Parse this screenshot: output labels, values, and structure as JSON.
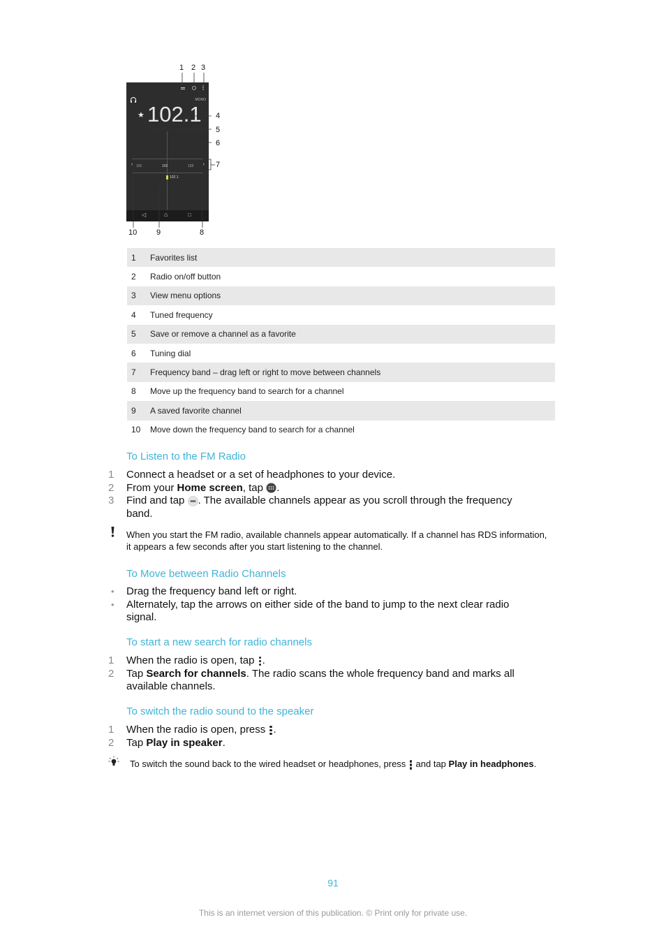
{
  "figure": {
    "callouts_top": [
      "1",
      "2",
      "3"
    ],
    "callouts_right": [
      "4",
      "5",
      "6",
      "7"
    ],
    "callouts_bottom": [
      "10",
      "9",
      "8"
    ],
    "screen": {
      "mode_label": "MONO",
      "tuned_frequency": "102.1",
      "band_labels": [
        "101",
        "102",
        "103"
      ],
      "favorite_channel": "102.1"
    }
  },
  "legend": [
    {
      "num": "1",
      "text": "Favorites list"
    },
    {
      "num": "2",
      "text": "Radio on/off button"
    },
    {
      "num": "3",
      "text": "View menu options"
    },
    {
      "num": "4",
      "text": "Tuned frequency"
    },
    {
      "num": "5",
      "text": "Save or remove a channel as a favorite"
    },
    {
      "num": "6",
      "text": "Tuning dial"
    },
    {
      "num": "7",
      "text": "Frequency band – drag left or right to move between channels"
    },
    {
      "num": "8",
      "text": "Move up the frequency band to search for a channel"
    },
    {
      "num": "9",
      "text": "A saved favorite channel"
    },
    {
      "num": "10",
      "text": "Move down the frequency band to search for a channel"
    }
  ],
  "sections": {
    "listen": {
      "heading": "To Listen to the FM Radio",
      "steps": [
        {
          "num": "1",
          "text": "Connect a headset or a set of headphones to your device."
        },
        {
          "num": "2",
          "pre": "From your ",
          "bold": "Home screen",
          "post": ", tap ",
          "end": "."
        },
        {
          "num": "3",
          "pre": "Find and tap ",
          "post": ". The available channels appear as you scroll through the frequency band."
        }
      ],
      "note": "When you start the FM radio, available channels appear automatically. If a channel has RDS information, it appears a few seconds after you start listening to the channel."
    },
    "move": {
      "heading": "To Move between Radio Channels",
      "bullets": [
        "Drag the frequency band left or right.",
        "Alternately, tap the arrows on either side of the band to jump to the next clear radio signal."
      ]
    },
    "search": {
      "heading": "To start a new search for radio channels",
      "steps": [
        {
          "num": "1",
          "pre": "When the radio is open, tap ",
          "end": "."
        },
        {
          "num": "2",
          "pre": "Tap ",
          "bold": "Search for channels",
          "post": ". The radio scans the whole frequency band and marks all available channels."
        }
      ]
    },
    "speaker": {
      "heading": "To switch the radio sound to the speaker",
      "steps": [
        {
          "num": "1",
          "pre": "When the radio is open, press ",
          "end": "."
        },
        {
          "num": "2",
          "pre": "Tap ",
          "bold": "Play in speaker",
          "post": "."
        }
      ],
      "tip": {
        "pre": "To switch the sound back to the wired headset or headphones, press ",
        "mid": " and tap ",
        "bold": "Play in headphones",
        "post": "."
      }
    }
  },
  "footer": {
    "page_number": "91",
    "notice": "This is an internet version of this publication. © Print only for private use."
  },
  "colors": {
    "heading": "#3fb4d6",
    "legend_shade": "#e8e8e8",
    "phone_bg": "#2d2d2d",
    "favorite_marker": "#d8d84a"
  }
}
